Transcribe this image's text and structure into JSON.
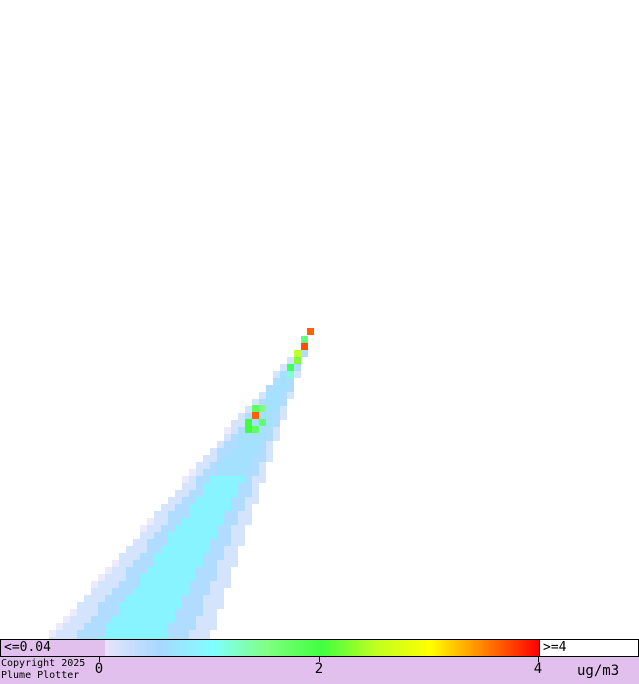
{
  "map": {
    "description_hidden": false,
    "background": "#ffffff"
  },
  "legend": {
    "low_label": "<=0.04",
    "high_label": ">=4",
    "ticks": [
      "0",
      "2",
      "4"
    ],
    "units": "ug/m3",
    "copyright_line1": "Copyright 2025",
    "copyright_line2": "Plume Plotter",
    "colors": {
      "low": "#e2c0ee",
      "gradient": [
        "#e8e4fa",
        "#a8d8ff",
        "#80ffff",
        "#80ff80",
        "#40ff40",
        "#c0ff20",
        "#ffff00",
        "#ff8000",
        "#ff0000"
      ]
    }
  }
}
